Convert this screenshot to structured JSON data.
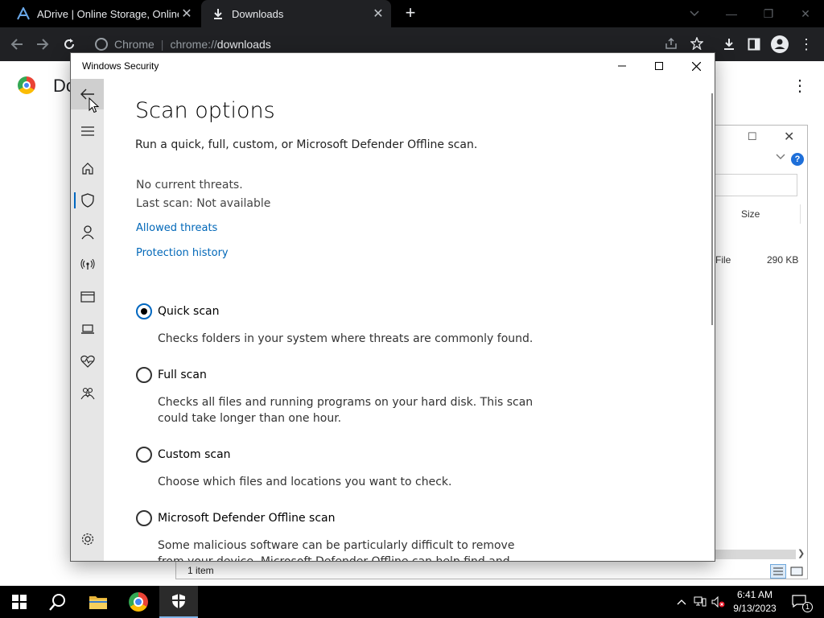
{
  "browser": {
    "tabs": [
      {
        "title": "ADrive | Online Storage, Online B",
        "close": "✕"
      },
      {
        "title": "Downloads",
        "close": "✕"
      }
    ],
    "new_tab": "+",
    "omnibox": {
      "site": "Chrome",
      "separator": "|",
      "scheme": "chrome://",
      "path": "downloads"
    },
    "page_title": "Do",
    "page_menu": "⋮",
    "window_controls": {
      "minimize": "—",
      "restore": "❐",
      "close": "✕"
    }
  },
  "explorer": {
    "column_size": "Size",
    "file_type": "File",
    "file_size": "290 KB",
    "status": "1 item",
    "help": "?"
  },
  "security": {
    "window_title": "Windows Security",
    "heading": "Scan options",
    "subtitle": "Run a quick, full, custom, or Microsoft Defender Offline scan.",
    "status_threats": "No current threats.",
    "status_last_scan": "Last scan: Not available",
    "links": {
      "allowed_threats": "Allowed threats",
      "protection_history": "Protection history"
    },
    "options": [
      {
        "label": "Quick scan",
        "desc": "Checks folders in your system where threats are commonly found.",
        "selected": true
      },
      {
        "label": "Full scan",
        "desc": "Checks all files and running programs on your hard disk. This scan could take longer than one hour.",
        "selected": false
      },
      {
        "label": "Custom scan",
        "desc": "Choose which files and locations you want to check.",
        "selected": false
      },
      {
        "label": "Microsoft Defender Offline scan",
        "desc": "Some malicious software can be particularly difficult to remove from your device. Microsoft Defender Offline can help find and remove",
        "selected": false
      }
    ],
    "accent_color": "#0067c0",
    "link_color": "#0067b8"
  },
  "taskbar": {
    "time": "6:41 AM",
    "date": "9/13/2023",
    "notification_count": "1"
  }
}
